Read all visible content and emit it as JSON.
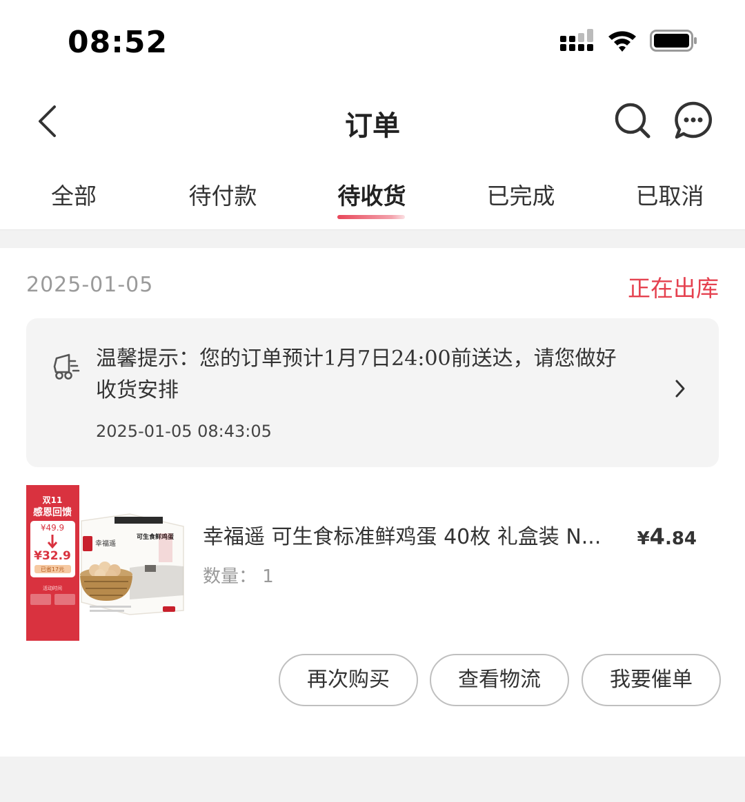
{
  "status_bar": {
    "time": "08:52"
  },
  "nav": {
    "title": "订单"
  },
  "tabs": [
    {
      "label": "全部",
      "active": false
    },
    {
      "label": "待付款",
      "active": false
    },
    {
      "label": "待收货",
      "active": true
    },
    {
      "label": "已完成",
      "active": false
    },
    {
      "label": "已取消",
      "active": false
    }
  ],
  "order": {
    "date": "2025-01-05",
    "status": "正在出库",
    "notice": {
      "text": "温馨提示：您的订单预计1月7日24:00前送达，请您做好收货安排",
      "time": "2025-01-05 08:43:05"
    },
    "product": {
      "name": "幸福遥 可生食标准鲜鸡蛋 40枚 礼盒装 N...",
      "quantity_label": "数量：",
      "quantity": "1",
      "price_symbol": "¥",
      "price_int": "4",
      "price_dec": ".84",
      "image": {
        "badge_top": "双11",
        "badge_title": "感恩回馈",
        "old_price": "¥49.9",
        "new_price": "¥32.9",
        "save": "已省17元",
        "activity": "活动时间",
        "brand": "幸福遥",
        "box_text": "可生食鲜鸡蛋"
      }
    },
    "actions": {
      "rebuy": "再次购买",
      "logistics": "查看物流",
      "urge": "我要催单"
    }
  },
  "colors": {
    "accent": "#e5414f",
    "bg": "#f2f2f2"
  }
}
